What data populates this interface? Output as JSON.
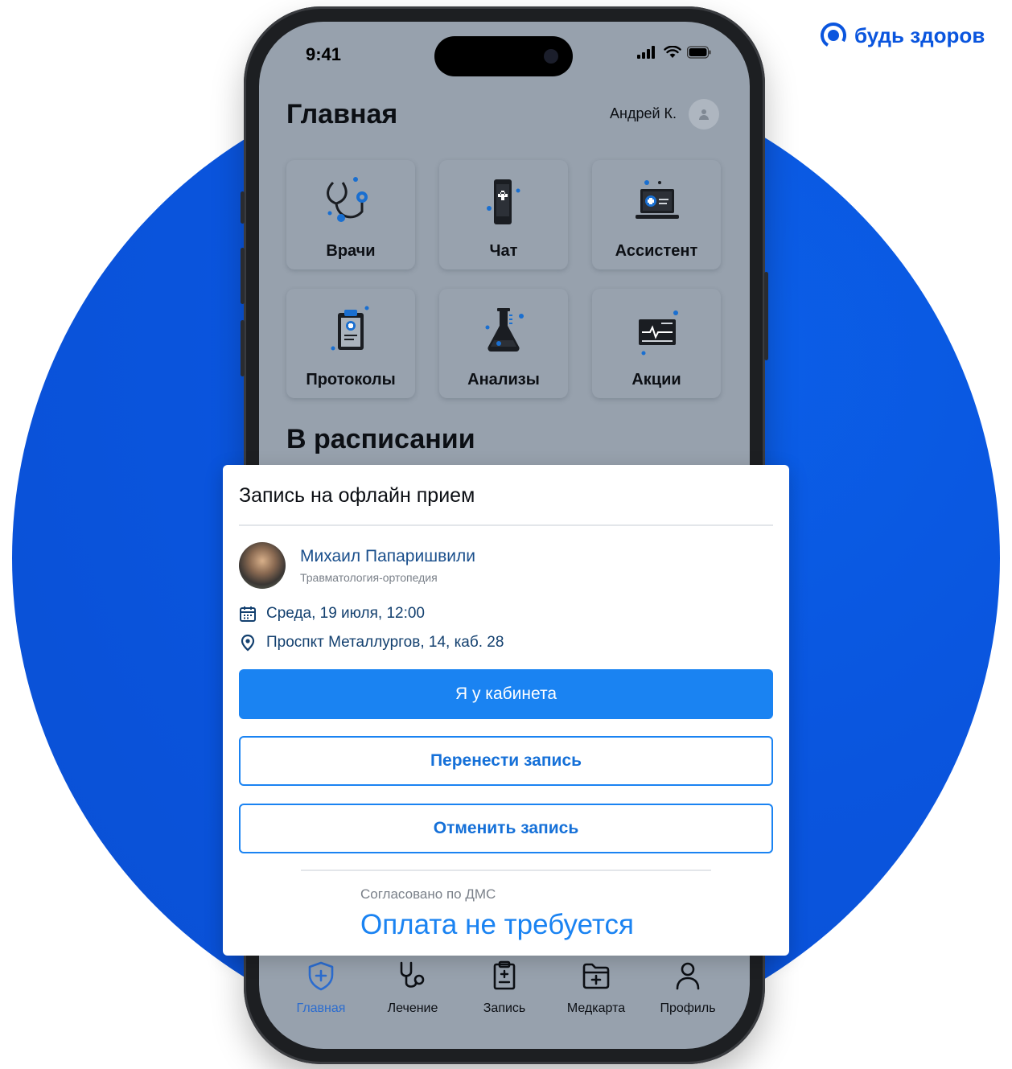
{
  "brand": {
    "logo_text": "будь здоров",
    "accent": "#0a55de"
  },
  "status_bar": {
    "time": "9:41"
  },
  "home": {
    "title": "Главная",
    "user_name": "Андрей К.",
    "tiles": [
      {
        "label": "Врачи",
        "icon": "stethoscope-icon"
      },
      {
        "label": "Чат",
        "icon": "phone-medical-icon"
      },
      {
        "label": "Ассистент",
        "icon": "laptop-medical-icon"
      },
      {
        "label": "Протоколы",
        "icon": "clipboard-icon"
      },
      {
        "label": "Анализы",
        "icon": "flask-icon"
      },
      {
        "label": "Акции",
        "icon": "card-icon"
      }
    ],
    "section_title": "В расписании"
  },
  "appointment": {
    "title": "Запись на офлайн прием",
    "doctor_name": "Михаил Папаришвили",
    "doctor_specialty": "Травматология-ортопедия",
    "datetime": "Среда, 19 июля, 12:00",
    "address": "Проспкт Металлургов, 14, каб. 28",
    "primary_button": "Я у кабинета",
    "reschedule_button": "Перенести запись",
    "cancel_button": "Отменить запись",
    "dms_note": "Согласовано по ДМС",
    "payment_note": "Оплата не требуется"
  },
  "tabbar": {
    "items": [
      {
        "label": "Главная",
        "icon": "shield-plus-icon",
        "active": true
      },
      {
        "label": "Лечение",
        "icon": "stethoscope-icon",
        "active": false
      },
      {
        "label": "Запись",
        "icon": "clipboard-icon",
        "active": false
      },
      {
        "label": "Медкарта",
        "icon": "folder-plus-icon",
        "active": false
      },
      {
        "label": "Профиль",
        "icon": "person-icon",
        "active": false
      }
    ]
  },
  "colors": {
    "primary": "#1a83f2",
    "screen_overlay": "#97a1ad",
    "active_tab": "#2b6ccf"
  }
}
